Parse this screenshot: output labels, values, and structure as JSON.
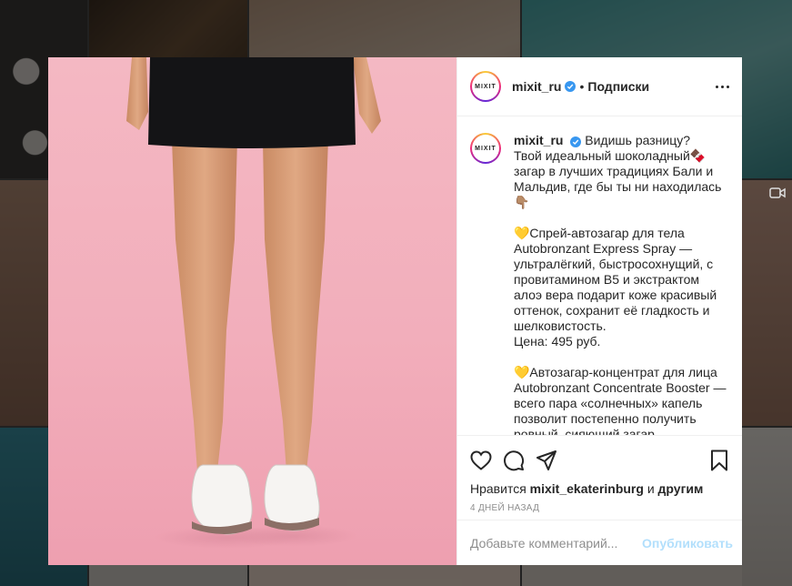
{
  "post": {
    "username": "mixit_ru",
    "separator": "•",
    "follow_label": "Подписки",
    "avatar_text": "MIXIT",
    "caption": "Видишь разницу?\nТвой идеальный шоколадный🍫 загар в лучших традициях Бали и Мальдив, где бы ты ни находилась 👇🏽\n\n💛Спрей-автозагар для тела Autobronzant Express Spray — ультралёгкий, быстросохнущий, с провитамином B5 и экстрактом алоэ вера подарит коже красивый оттенок, сохранит её гладкость и шелковистость.\nЦена: 495 руб.\n\n💛Автозагар-концентрат для лица Autobronzant Concentrate Booster — всего пара «солнечных» капель позволит постепенно получить ровный, сияющий загар.",
    "likes_prefix": "Нравится",
    "likes_user": "mixit_ekaterinburg",
    "likes_and": "и",
    "likes_others": "другим",
    "date": "4 ДНЕЙ НАЗАД"
  },
  "comment": {
    "placeholder": "Добавьте комментарий...",
    "publish_label": "Опубликовать"
  },
  "icons": {
    "like": "heart-icon",
    "comment": "comment-icon",
    "share": "share-icon",
    "save": "bookmark-icon",
    "more": "more-icon",
    "verified": "verified-badge-icon"
  },
  "colors": {
    "accent_blue": "#3897f0",
    "publish_disabled": "#b2dffc",
    "photo_bg": "#f2aebb"
  }
}
